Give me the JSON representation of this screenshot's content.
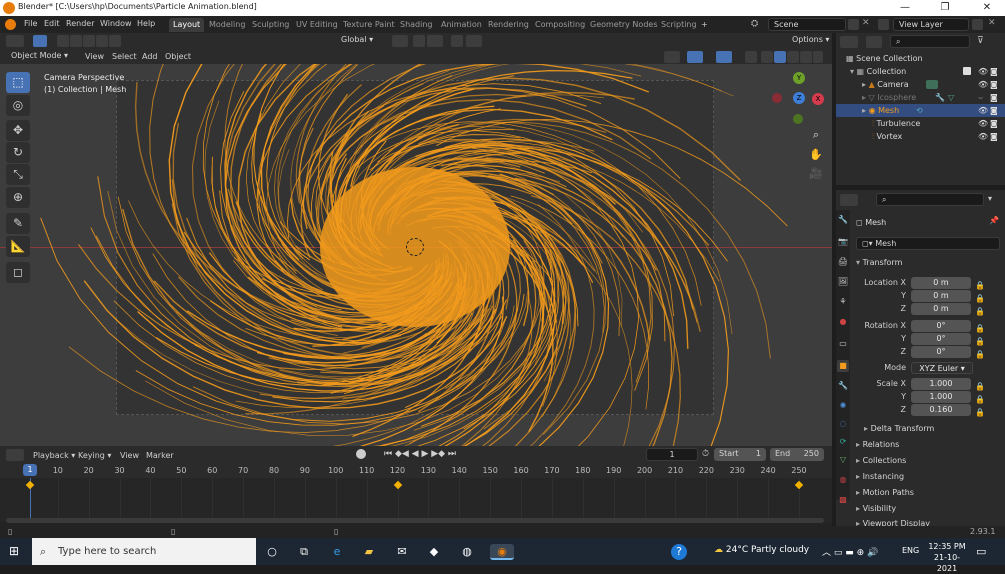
{
  "window": {
    "title": "Blender* [C:\\Users\\hp\\Documents\\Particle Animation.blend]",
    "min": "—",
    "max": "❐",
    "close": "✕"
  },
  "menu": {
    "items": [
      "File",
      "Edit",
      "Render",
      "Window",
      "Help"
    ],
    "workspaces": [
      "Layout",
      "Modeling",
      "Sculpting",
      "UV Editing",
      "Texture Paint",
      "Shading",
      "Animation",
      "Rendering",
      "Compositing",
      "Geometry Nodes",
      "Scripting"
    ],
    "add": "+",
    "scene": "Scene",
    "view_layer": "View Layer"
  },
  "viewport_header": {
    "transform": "Global",
    "options": "Options",
    "mode": "Object Mode",
    "menus": [
      "View",
      "Select",
      "Add",
      "Object"
    ]
  },
  "viewport": {
    "camera_label": "Camera Perspective",
    "collection_label": "(1) Collection | Mesh",
    "gizmo": {
      "x": "X",
      "y": "Y",
      "z": "Z"
    },
    "accent_color": "#f39b1c"
  },
  "outliner": {
    "root": "Scene Collection",
    "items": [
      {
        "name": "Collection",
        "depth": 0
      },
      {
        "name": "Camera",
        "depth": 1
      },
      {
        "name": "Icosphere",
        "depth": 1
      },
      {
        "name": "Mesh",
        "depth": 1
      },
      {
        "name": "Turbulence",
        "depth": 1
      },
      {
        "name": "Vortex",
        "depth": 1
      }
    ]
  },
  "properties": {
    "object_name": "Mesh",
    "data_name": "Mesh",
    "transform_title": "Transform",
    "location": {
      "label": "Location X",
      "x": "0 m",
      "y": "0 m",
      "z": "0 m"
    },
    "rotation": {
      "label": "Rotation X",
      "x": "0°",
      "y": "0°",
      "z": "0°"
    },
    "mode": {
      "label": "Mode",
      "value": "XYZ Euler"
    },
    "scale": {
      "label": "Scale X",
      "x": "1.000",
      "y": "1.000",
      "z": "0.160"
    },
    "axis": {
      "y": "Y",
      "z": "Z"
    },
    "sections": [
      "Delta Transform",
      "Relations",
      "Collections",
      "Instancing",
      "Motion Paths",
      "Visibility",
      "Viewport Display"
    ]
  },
  "timeline": {
    "menus": [
      "Playback",
      "Keying",
      "View",
      "Marker"
    ],
    "current_frame": "1",
    "start_label": "Start",
    "start": "1",
    "end_label": "End",
    "end": "250",
    "ticks": [
      "1",
      "10",
      "20",
      "30",
      "40",
      "50",
      "60",
      "70",
      "80",
      "90",
      "100",
      "110",
      "120",
      "130",
      "140",
      "150",
      "160",
      "170",
      "180",
      "190",
      "200",
      "210",
      "220",
      "230",
      "240",
      "250"
    ],
    "keyframes": [
      1,
      120,
      250
    ]
  },
  "status": {
    "version": "2.93.1"
  },
  "taskbar": {
    "search": "Type here to search",
    "weather": "24°C  Partly cloudy",
    "lang": "ENG",
    "time": "12:35 PM",
    "date": "21-10-2021"
  }
}
